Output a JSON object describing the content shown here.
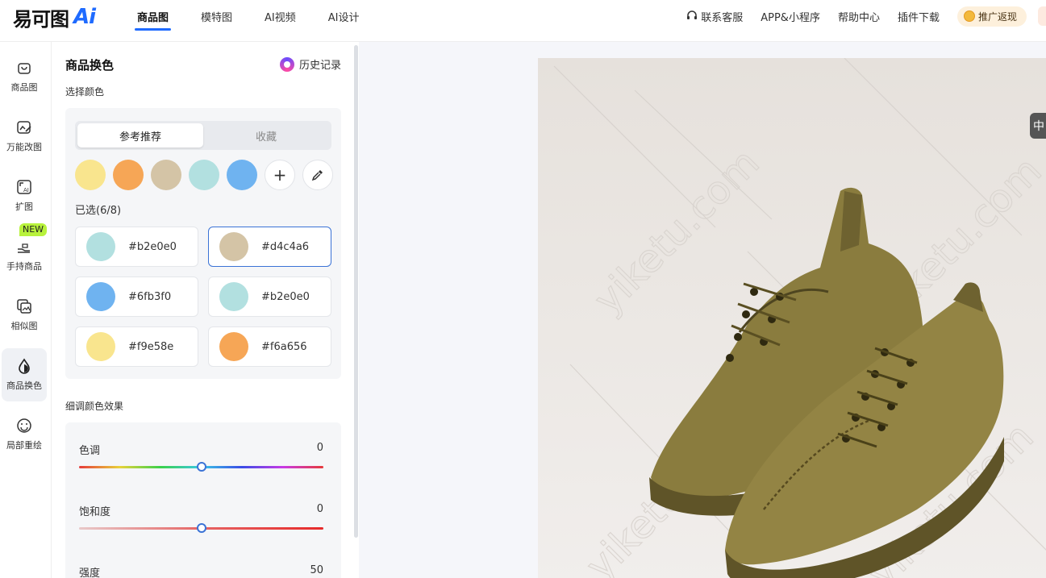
{
  "header": {
    "logo_text": "易可图",
    "logo_ai": "Ai",
    "tabs": [
      {
        "label": "商品图",
        "active": true
      },
      {
        "label": "模特图",
        "active": false
      },
      {
        "label": "AI视频",
        "active": false
      },
      {
        "label": "AI设计",
        "active": false
      }
    ],
    "right_links": {
      "service": "联系客服",
      "app": "APP&小程序",
      "help": "帮助中心",
      "plugin": "插件下载",
      "promo": "推广返现"
    }
  },
  "sidebar": {
    "items": [
      {
        "label": "商品图",
        "icon": "bag-icon",
        "active": false
      },
      {
        "label": "万能改图",
        "icon": "edit-image-icon",
        "active": false
      },
      {
        "label": "扩图",
        "icon": "expand-ai-icon",
        "active": false
      },
      {
        "label": "手持商品",
        "icon": "hand-hold-icon",
        "active": false
      },
      {
        "label": "相似图",
        "icon": "similar-image-icon",
        "active": false
      },
      {
        "label": "商品换色",
        "icon": "color-drop-icon",
        "active": true
      },
      {
        "label": "局部重绘",
        "icon": "smile-face-icon",
        "active": false
      }
    ],
    "new_badge": "NEW"
  },
  "panel": {
    "title": "商品换色",
    "history_label": "历史记录",
    "select_color_label": "选择颜色",
    "segment_tabs": [
      {
        "label": "参考推荐",
        "active": true
      },
      {
        "label": "收藏",
        "active": false
      }
    ],
    "swatches": [
      "#f9e58e",
      "#f6a656",
      "#d4c4a6",
      "#b2e0e0",
      "#6fb3f0"
    ],
    "selected_count_label": "已选(6/8)",
    "selected_colors": [
      {
        "hex": "#b2e0e0",
        "label": "#b2e0e0",
        "active": false
      },
      {
        "hex": "#d4c4a6",
        "label": "#d4c4a6",
        "active": true
      },
      {
        "hex": "#6fb3f0",
        "label": "#6fb3f0",
        "active": false
      },
      {
        "hex": "#b2e0e0",
        "label": "#b2e0e0",
        "active": false
      },
      {
        "hex": "#f9e58e",
        "label": "#f9e58e",
        "active": false
      },
      {
        "hex": "#f6a656",
        "label": "#f6a656",
        "active": false
      }
    ],
    "fine_tune_label": "细调颜色效果",
    "sliders": [
      {
        "label": "色调",
        "value": "0",
        "position": 0.5
      },
      {
        "label": "饱和度",
        "value": "0",
        "position": 0.5
      },
      {
        "label": "强度",
        "value": "50",
        "position": 0.5
      }
    ]
  },
  "canvas": {
    "watermark": "yiketu.com",
    "zoom_label": "中"
  },
  "colors": {
    "accent": "#1f6bff",
    "selected_border": "#3b73d6",
    "shoe": "#8a7c3e"
  }
}
